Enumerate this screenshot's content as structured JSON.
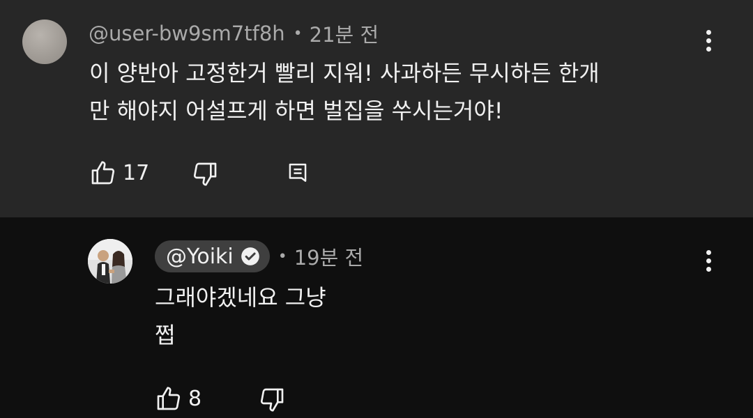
{
  "comment": {
    "author": "@user-bw9sm7tf8h",
    "time": "21분 전",
    "body_line1": "이 양반아 고정한거 빨리 지워! 사과하든 무시하든 한개",
    "body_line2": "만 해야지 어설프게 하면 벌집을 쑤시는거야!",
    "like_count": "17",
    "icons": [
      "avatar",
      "more-vert-icon",
      "thumbs-up-icon",
      "thumbs-down-icon",
      "reply-icon"
    ]
  },
  "reply": {
    "author": "@Yoiki",
    "verified": true,
    "time": "19분 전",
    "body_line1": "그래야겠네요 그냥",
    "body_line2": "쩝",
    "like_count": "8",
    "icons": [
      "avatar",
      "verified-check-icon",
      "more-vert-icon",
      "thumbs-up-icon",
      "thumbs-down-icon"
    ]
  },
  "colors": {
    "top_comment_bg": "#272727",
    "page_bg": "#0f0f0f",
    "primary_text": "#f1f1f1",
    "secondary_text": "#aaaaaa",
    "author_pill_bg": "#3f3f3f"
  }
}
